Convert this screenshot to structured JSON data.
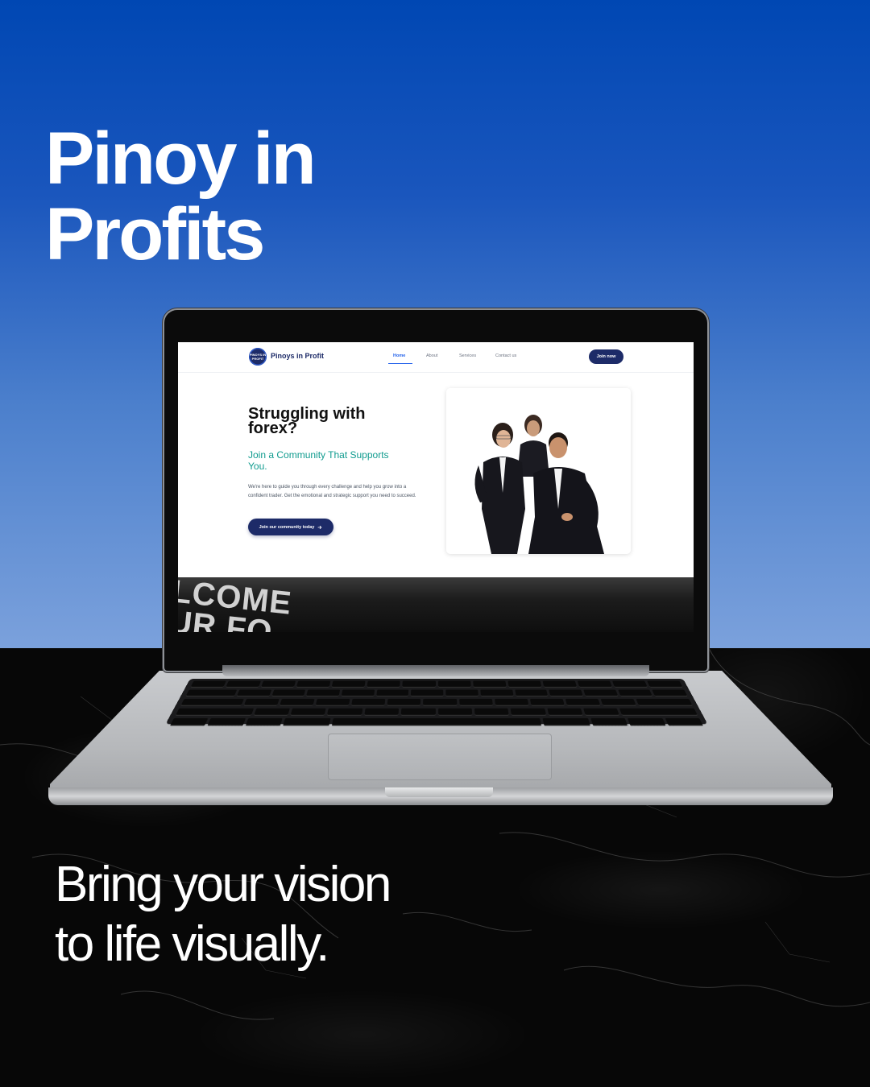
{
  "headline": {
    "line1": "Pinoy in",
    "line2": "Profits"
  },
  "tagline": {
    "line1": "Bring your vision",
    "line2": "to life visually."
  },
  "website": {
    "logo": {
      "text": "PINOYS IN PROFIT"
    },
    "brand_name": "Pinoys in Profit",
    "nav": {
      "home": "Home",
      "about": "About",
      "services": "Services",
      "contact": "Contact us"
    },
    "join_button": "Join now",
    "hero": {
      "title": "Struggling with forex?",
      "subtitle": "Join a Community That Supports You.",
      "body": "We're here to guide you through every challenge and help you grow into a confident trader. Get the emotional and strategic support you need to succeed.",
      "cta_label": "Join our community today",
      "cta_icon": "arrow-right-icon"
    },
    "banner_text_line1": "LCOME",
    "banner_text_line2": "UR FO"
  },
  "colors": {
    "background_blue": "#0047b3",
    "navy": "#1d2b68",
    "teal": "#0f9b8e",
    "link_blue": "#2563eb",
    "laptop_silver": "#c9cbce"
  }
}
